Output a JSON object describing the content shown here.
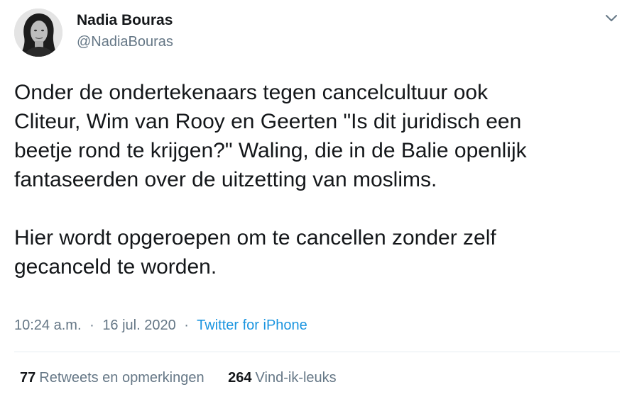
{
  "tweet": {
    "author": {
      "name": "Nadia Bouras",
      "handle": "@NadiaBouras",
      "avatar_icon": "profile-photo"
    },
    "menu_icon": "chevron-down-icon",
    "body_lines": [
      "Onder de ondertekenaars tegen cancelcultuur ook",
      "Cliteur, Wim van Rooy en Geerten  \"Is dit juridisch een",
      "beetje rond te krijgen?\" Waling, die in de Balie openlijk",
      "fantaseerden over de uitzetting van moslims."
    ],
    "body_lines_2": [
      "Hier wordt opgeroepen om te cancellen zonder zelf",
      "gecanceld te worden."
    ],
    "meta": {
      "time": "10:24 a.m.",
      "separator": "·",
      "date": "16 jul. 2020",
      "source": "Twitter for iPhone"
    },
    "stats": {
      "retweets_count": "77",
      "retweets_label": "Retweets en opmerkingen",
      "likes_count": "264",
      "likes_label": "Vind-ik-leuks"
    }
  },
  "colors": {
    "text": "#14171a",
    "secondary": "#657786",
    "link": "#1b95e0",
    "divider": "#e6ecf0"
  }
}
